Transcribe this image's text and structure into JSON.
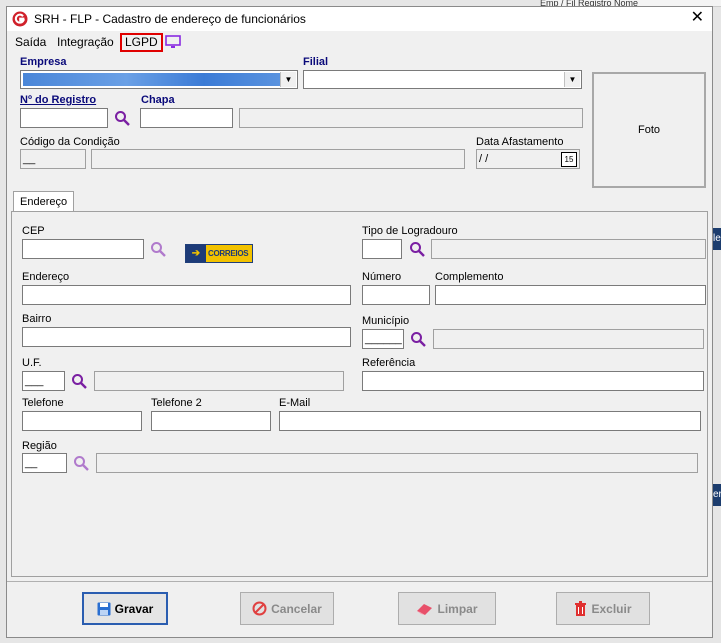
{
  "window": {
    "title": "SRH - FLP - Cadastro de endereço de funcionários",
    "close_glyph": "✕"
  },
  "background": {
    "top_text": "Emp / Fil   Registro  Nome",
    "side_text_1": "le",
    "side_text_2": "er"
  },
  "menu": {
    "items": [
      "Saída",
      "Integração",
      "LGPD"
    ],
    "monitor_icon": "monitor-icon",
    "lgpd_highlight_color": "#e00000",
    "monitor_color": "#8a2be2"
  },
  "header": {
    "empresa_label": "Empresa",
    "filial_label": "Filial",
    "registro_label": "Nº do Registro",
    "chapa_label": "Chapa",
    "codigo_condicao_label": "Código da Condição",
    "data_afastamento_label": "Data Afastamento",
    "data_afastamento_value": " /  /",
    "codigo_condicao_value": "__",
    "calendar_text": "15",
    "foto_label": "Foto"
  },
  "tabs": [
    {
      "label": "Endereço"
    }
  ],
  "endereco": {
    "cep_label": "CEP",
    "correios_text": "CORREIOS",
    "tipo_logradouro_label": "Tipo de Logradouro",
    "endereco_label": "Endereço",
    "numero_label": "Número",
    "complemento_label": "Complemento",
    "bairro_label": "Bairro",
    "municipio_label": "Município",
    "municipio_value": "______",
    "uf_label": "U.F.",
    "uf_value": "___",
    "referencia_label": "Referência",
    "telefone_label": "Telefone",
    "telefone2_label": "Telefone 2",
    "email_label": "E-Mail",
    "regiao_label": "Região",
    "regiao_value": "__"
  },
  "buttons": {
    "gravar": "Gravar",
    "cancelar": "Cancelar",
    "limpar": "Limpar",
    "excluir": "Excluir"
  },
  "colors": {
    "lupa": "#7a1fa2",
    "label_bold": "#0a0a7a",
    "primary_border": "#2a5db0",
    "empresa_selected": "#3b7bd6"
  }
}
